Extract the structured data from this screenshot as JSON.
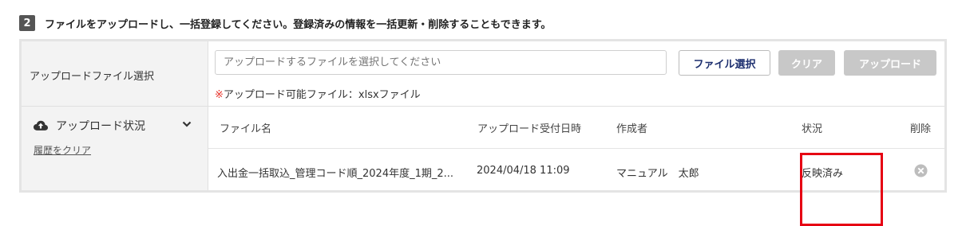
{
  "step": {
    "number": "2",
    "title": "ファイルをアップロードし、一括登録してください。登録済みの情報を一括更新・削除することもできます。"
  },
  "upload": {
    "label": "アップロードファイル選択",
    "placeholder": "アップロードするファイルを選択してください",
    "select_button": "ファイル選択",
    "clear_button": "クリア",
    "upload_button": "アップロード",
    "note_mark": "※",
    "note_text": "アップロード可能ファイル：xlsxファイル"
  },
  "status_section": {
    "title": "アップロード状況",
    "clear_history": "履歴をクリア",
    "columns": [
      "ファイル名",
      "アップロード受付日時",
      "作成者",
      "状況",
      "削除"
    ],
    "rows": [
      {
        "file_name": "入出金一括取込_管理コード順_2024年度_1期_2...",
        "uploaded_at": "2024/04/18 11:09",
        "creator": "マニュアル　太郎",
        "status": "反映済み"
      }
    ]
  },
  "icons": {
    "cloud": "cloud-upload-icon",
    "chevron": "chevron-down-icon",
    "delete": "close-circle-icon"
  },
  "colors": {
    "accent_navy": "#1d2f6f",
    "disabled_button": "#c8c8c8",
    "note_mark": "#e8332a",
    "highlight": "#e60012"
  }
}
